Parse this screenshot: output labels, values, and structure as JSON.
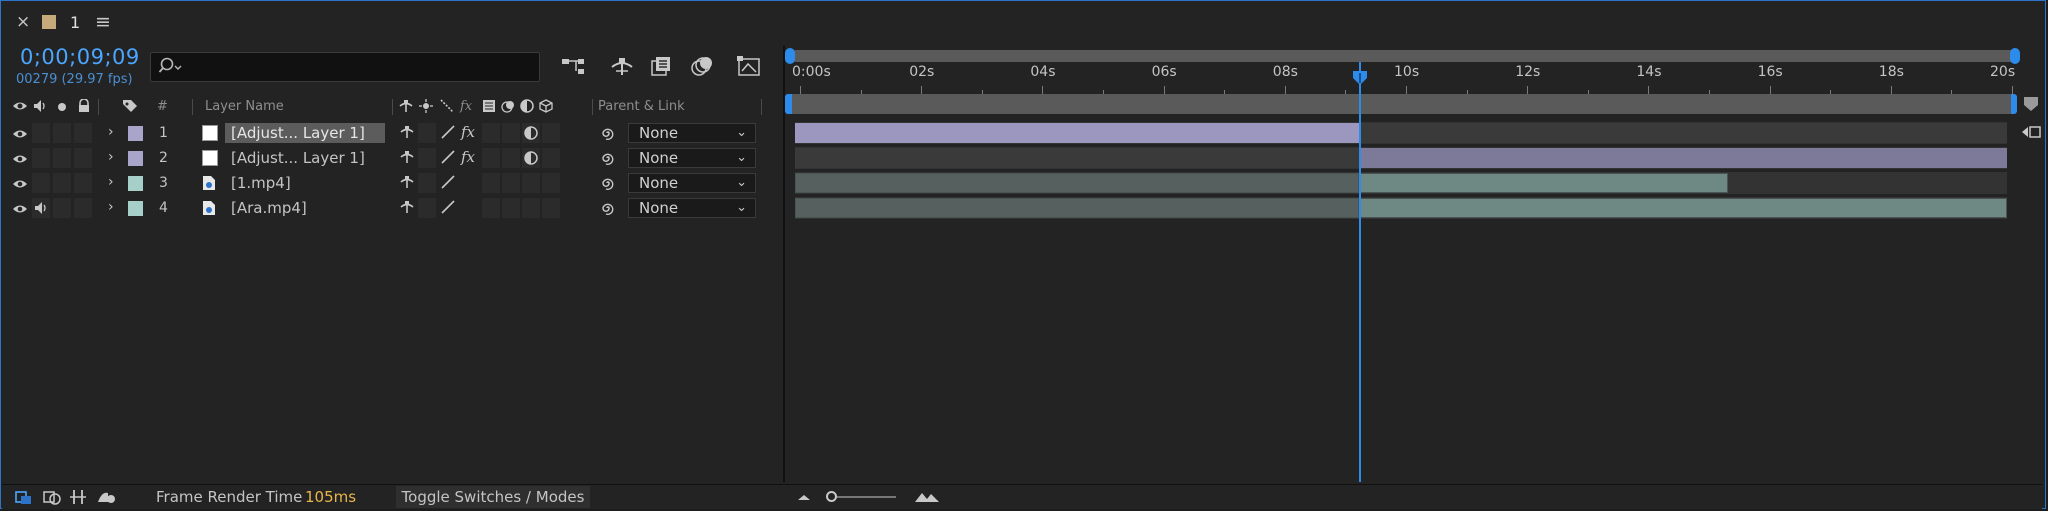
{
  "comp": {
    "close_icon": "×",
    "tab_label": "1",
    "menu_icon": "≡",
    "swatch_color": "#c7aa7c"
  },
  "timecode": "0;00;09;09",
  "frame_info": "00279 (29.97 fps)",
  "search": {
    "placeholder": ""
  },
  "columns": {
    "number": "#",
    "layer_name": "Layer Name",
    "parent_link": "Parent & Link"
  },
  "layers": [
    {
      "number": "1",
      "name": "[Adjust... Layer 1]",
      "label_color": "#a9a4c9",
      "type": "adjustment",
      "parent": "None",
      "fx": true,
      "selected": true
    },
    {
      "number": "2",
      "name": "[Adjust... Layer 1]",
      "label_color": "#a9a4c9",
      "type": "adjustment",
      "parent": "None",
      "fx": true,
      "selected": false
    },
    {
      "number": "3",
      "name": "[1.mp4]",
      "label_color": "#a7cfc9",
      "type": "footage",
      "parent": "None",
      "fx": false,
      "selected": false
    },
    {
      "number": "4",
      "name": "[Ara.mp4]",
      "label_color": "#a7cfc9",
      "type": "footage",
      "parent": "None",
      "fx": false,
      "selected": false
    }
  ],
  "ruler": {
    "labels": [
      "0:00s",
      "02s",
      "04s",
      "06s",
      "08s",
      "10s",
      "12s",
      "14s",
      "16s",
      "18s",
      "20s"
    ],
    "duration_seconds": 20,
    "current_time_seconds": 9.31
  },
  "bars": [
    {
      "layer": 1,
      "start": 0,
      "end": 9.31,
      "color": "#9b97bf",
      "color_after": "#3a3a3a"
    },
    {
      "layer": 2,
      "start": 9.31,
      "end": 20,
      "color": "#7d7a99",
      "color_before": "#3a3a3a"
    },
    {
      "layer": 3,
      "start": 0,
      "end": 15.4,
      "color": "#6e8884",
      "color_dim": "#56605f"
    },
    {
      "layer": 4,
      "start": 0,
      "end": 20,
      "color": "#6e8884",
      "color_dim": "#56605f"
    }
  ],
  "bottom": {
    "frame_render_label": "Frame Render Time",
    "frame_render_value": "105ms",
    "toggle_label": "Toggle Switches / Modes"
  }
}
